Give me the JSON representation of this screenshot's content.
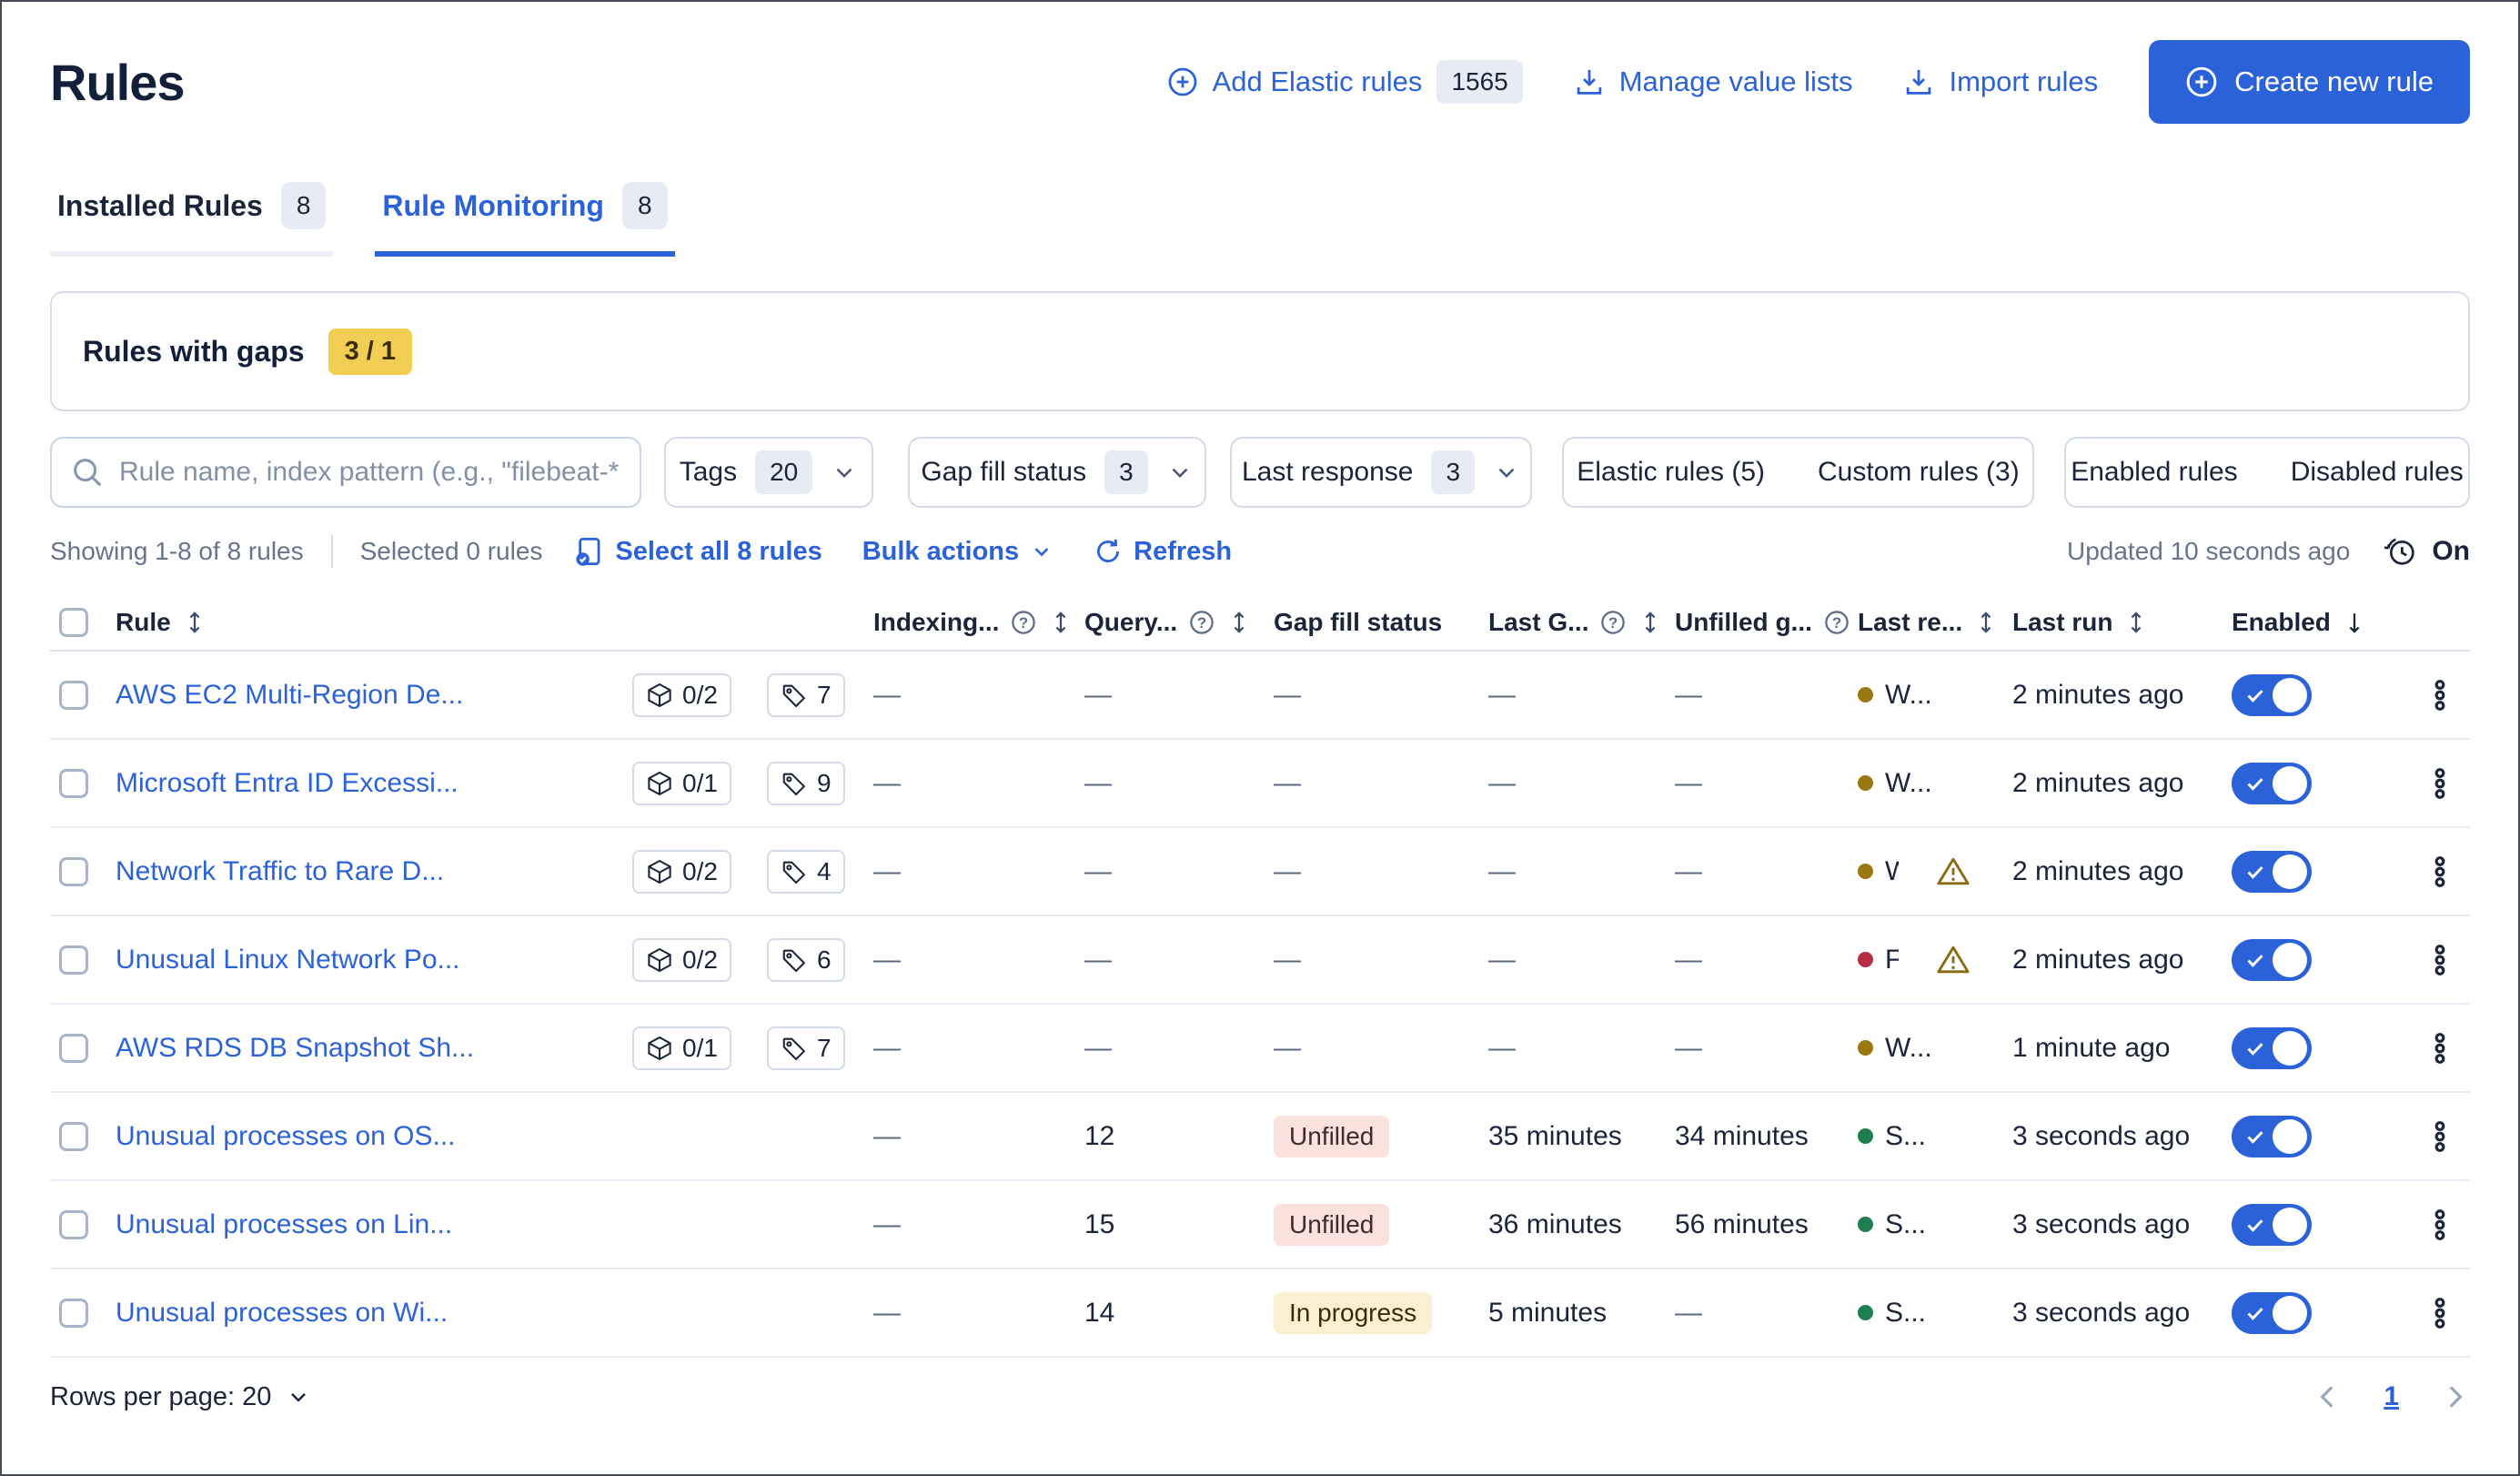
{
  "page": {
    "title": "Rules"
  },
  "colors": {
    "accent": "#2c62d9",
    "warning_badge_bg": "#f1ce53",
    "gap_unfilled_bg": "#fae2dd",
    "gap_inprogress_bg": "#fbf1d2",
    "dot_warning": "#9a7711",
    "dot_danger": "#b72d43",
    "dot_success": "#1e7e4f"
  },
  "header_actions": {
    "add_elastic_rules": "Add Elastic rules",
    "add_elastic_rules_count": "1565",
    "manage_value_lists": "Manage value lists",
    "import_rules": "Import rules",
    "create_new_rule": "Create new rule"
  },
  "tabs": [
    {
      "label": "Installed Rules",
      "count": "8",
      "active": false
    },
    {
      "label": "Rule Monitoring",
      "count": "8",
      "active": true
    }
  ],
  "gaps_panel": {
    "title": "Rules with gaps",
    "badge": "3 / 1"
  },
  "filters": {
    "search_placeholder": "Rule name, index pattern (e.g., \"filebeat-*",
    "tags_label": "Tags",
    "tags_count": "20",
    "gap_fill_label": "Gap fill status",
    "gap_fill_count": "3",
    "last_response_label": "Last response",
    "last_response_count": "3",
    "elastic_rules": "Elastic rules (5)",
    "custom_rules": "Custom rules (3)",
    "enabled_rules": "Enabled rules",
    "disabled_rules": "Disabled rules"
  },
  "utility": {
    "showing": "Showing 1-8 of 8 rules",
    "selected": "Selected 0 rules",
    "select_all": "Select all 8 rules",
    "bulk_actions": "Bulk actions",
    "refresh": "Refresh",
    "updated": "Updated 10 seconds ago",
    "auto_refresh": "On"
  },
  "table": {
    "columns": [
      {
        "label": "Rule",
        "help": false,
        "sort": "both"
      },
      {
        "label": "Indexing...",
        "help": true,
        "sort": "both"
      },
      {
        "label": "Query...",
        "help": true,
        "sort": "both"
      },
      {
        "label": "Gap fill status",
        "help": false,
        "sort": null
      },
      {
        "label": "Last G...",
        "help": true,
        "sort": "both"
      },
      {
        "label": "Unfilled g...",
        "help": true,
        "sort": null
      },
      {
        "label": "Last re...",
        "help": false,
        "sort": "both"
      },
      {
        "label": "Last run",
        "help": false,
        "sort": "both"
      },
      {
        "label": "Enabled",
        "help": false,
        "sort": "down"
      }
    ],
    "rows": [
      {
        "name": "AWS EC2 Multi-Region De...",
        "integrations": "0/2",
        "tags": "7",
        "indexing": "—",
        "query": "—",
        "gap_status": null,
        "last_gap": "—",
        "unfilled_gap": "—",
        "response": {
          "text": "W...",
          "status": "warning",
          "alert": false,
          "clip": false
        },
        "last_run": "2 minutes ago",
        "enabled": true
      },
      {
        "name": "Microsoft Entra ID Excessi...",
        "integrations": "0/1",
        "tags": "9",
        "indexing": "—",
        "query": "—",
        "gap_status": null,
        "last_gap": "—",
        "unfilled_gap": "—",
        "response": {
          "text": "W...",
          "status": "warning",
          "alert": false,
          "clip": false
        },
        "last_run": "2 minutes ago",
        "enabled": true
      },
      {
        "name": "Network Traffic to Rare D...",
        "integrations": "0/2",
        "tags": "4",
        "indexing": "—",
        "query": "—",
        "gap_status": null,
        "last_gap": "—",
        "unfilled_gap": "—",
        "response": {
          "text": "W",
          "status": "warning",
          "alert": true,
          "clip": true
        },
        "last_run": "2 minutes ago",
        "enabled": true
      },
      {
        "name": "Unusual Linux Network Po...",
        "integrations": "0/2",
        "tags": "6",
        "indexing": "—",
        "query": "—",
        "gap_status": null,
        "last_gap": "—",
        "unfilled_gap": "—",
        "response": {
          "text": "F",
          "status": "danger",
          "alert": true,
          "clip": true
        },
        "last_run": "2 minutes ago",
        "enabled": true
      },
      {
        "name": "AWS RDS DB Snapshot Sh...",
        "integrations": "0/1",
        "tags": "7",
        "indexing": "—",
        "query": "—",
        "gap_status": null,
        "last_gap": "—",
        "unfilled_gap": "—",
        "response": {
          "text": "W...",
          "status": "warning",
          "alert": false,
          "clip": false
        },
        "last_run": "1 minute ago",
        "enabled": true
      },
      {
        "name": "Unusual processes on OS...",
        "integrations": null,
        "tags": null,
        "indexing": "—",
        "query": "12",
        "gap_status": {
          "label": "Unfilled",
          "type": "danger"
        },
        "last_gap": "35 minutes",
        "unfilled_gap": "34 minutes",
        "response": {
          "text": "S...",
          "status": "success",
          "alert": false,
          "clip": false
        },
        "last_run": "3 seconds ago",
        "enabled": true
      },
      {
        "name": "Unusual processes on Lin...",
        "integrations": null,
        "tags": null,
        "indexing": "—",
        "query": "15",
        "gap_status": {
          "label": "Unfilled",
          "type": "danger"
        },
        "last_gap": "36 minutes",
        "unfilled_gap": "56 minutes",
        "response": {
          "text": "S...",
          "status": "success",
          "alert": false,
          "clip": false
        },
        "last_run": "3 seconds ago",
        "enabled": true
      },
      {
        "name": "Unusual processes on Wi...",
        "integrations": null,
        "tags": null,
        "indexing": "—",
        "query": "14",
        "gap_status": {
          "label": "In progress",
          "type": "warning"
        },
        "last_gap": "5 minutes",
        "unfilled_gap": "—",
        "response": {
          "text": "S...",
          "status": "success",
          "alert": false,
          "clip": false
        },
        "last_run": "3 seconds ago",
        "enabled": true
      }
    ]
  },
  "footer": {
    "rows_per_page": "Rows per page: 20",
    "page": "1"
  }
}
